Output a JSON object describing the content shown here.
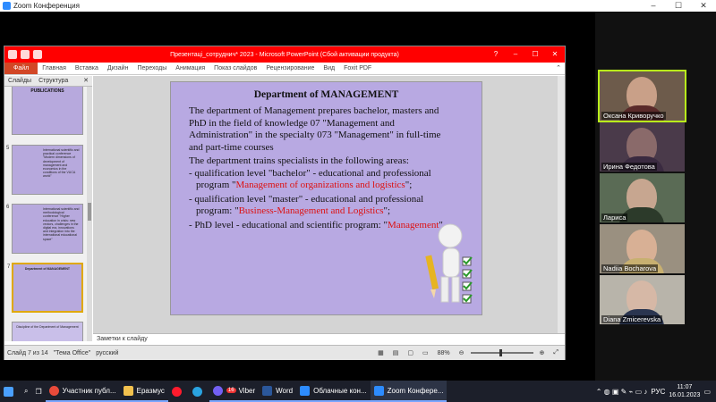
{
  "zoom": {
    "title": "Zoom Конференция",
    "controls": [
      "–",
      "☐",
      "✕"
    ]
  },
  "powerpoint": {
    "title": "Презентаці_сотруднич* 2023 - Microsoft PowerPoint (Сбой активации продукта)",
    "ribbon_tabs": [
      "Файл",
      "Главная",
      "Вставка",
      "Дизайн",
      "Переходы",
      "Анимация",
      "Показ слайдов",
      "Рецензирование",
      "Вид",
      "Foxit PDF"
    ],
    "pane_tabs": [
      "Слайды",
      "Структура"
    ],
    "thumbnails": [
      {
        "num": "",
        "text": "PUBLICATIONS"
      },
      {
        "num": "5",
        "text": "International scientific and practical conference \"Modern dimensions of development of management and economics in the conditions of the VUCA world\""
      },
      {
        "num": "6",
        "text": "International scientific and methodological conference \"Higher education in crisis: new vectors, challenges in the digital era, innovations and integration into the international educational space\""
      },
      {
        "num": "7",
        "text": "Department of MANAGEMENT"
      },
      {
        "num": "",
        "text": "Discipline of the Department of Management"
      }
    ],
    "slide": {
      "title": "Department of MANAGEMENT",
      "para1": "The department of Management prepares bachelor, masters and PhD in the field of knowledge 07 \"Management and Administration\" in the specialty 073 \"Management\" in full-time and part-time courses",
      "para2": "The department trains specialists in the following areas:",
      "bullets": [
        {
          "prefix": "- qualification level \"bachelor\" - educational and professional program \"",
          "highlight": "Management of organizations and logistics",
          "suffix": "\";"
        },
        {
          "prefix": "- qualification level \"master\" - educational and professional program: \"",
          "highlight": "Business-Management and Logistics",
          "suffix": "\";"
        },
        {
          "prefix": "- PhD level - educational and scientific program: \"",
          "highlight": "Management",
          "suffix": "\""
        }
      ]
    },
    "notes_placeholder": "Заметки к слайду",
    "status": {
      "slide_info": "Слайд 7 из 14",
      "theme": "\"Тема Office\"",
      "language": "русский",
      "zoom": "88%"
    }
  },
  "participants": [
    {
      "name": "Оксана Криворучко",
      "skin": "#c9a088",
      "clothes": "#5a2a2a",
      "bg": "#6d5b4b",
      "active": true
    },
    {
      "name": "Ирина Федотова",
      "skin": "#8a6a6a",
      "clothes": "#3a2a40",
      "bg": "#4a3a4a",
      "active": false
    },
    {
      "name": "Лариса",
      "skin": "#c7a690",
      "clothes": "#2c3a2a",
      "bg": "#5a6b55",
      "active": false
    },
    {
      "name": "Nadiia Bocharova",
      "skin": "#d8b095",
      "clothes": "#c8b070",
      "bg": "#9a9080",
      "active": false
    },
    {
      "name": "Diana Zmicerevska",
      "skin": "#d6b8a6",
      "clothes": "#2a3550",
      "bg": "#b8b4aa",
      "active": false
    }
  ],
  "taskbar": {
    "apps": [
      {
        "label": "",
        "icon": "windows-icon",
        "color": "#4aa0ff"
      },
      {
        "label": "",
        "icon": "search-icon",
        "color": "#888"
      },
      {
        "label": "",
        "icon": "task-view-icon",
        "color": "#888"
      },
      {
        "label": "Участник публ...",
        "icon": "chrome-icon",
        "color": "#e94a3a"
      },
      {
        "label": "Еразмус",
        "icon": "folder-icon",
        "color": "#f2c14e"
      },
      {
        "label": "",
        "icon": "opera-icon",
        "color": "#ff1b2d"
      },
      {
        "label": "",
        "icon": "telegram-icon",
        "color": "#2aa3e0"
      },
      {
        "label": "Viber",
        "icon": "viber-icon",
        "color": "#7360f2"
      },
      {
        "label": "Word",
        "icon": "word-icon",
        "color": "#2b579a"
      },
      {
        "label": "Облачные кон...",
        "icon": "zoom-icon",
        "color": "#2d8cff"
      },
      {
        "label": "Zoom Конфере...",
        "icon": "zoom-icon",
        "color": "#2d8cff"
      }
    ],
    "viber_badge": "16",
    "tray_language": "РУС",
    "time": "11:07",
    "date": "16.01.2023"
  }
}
